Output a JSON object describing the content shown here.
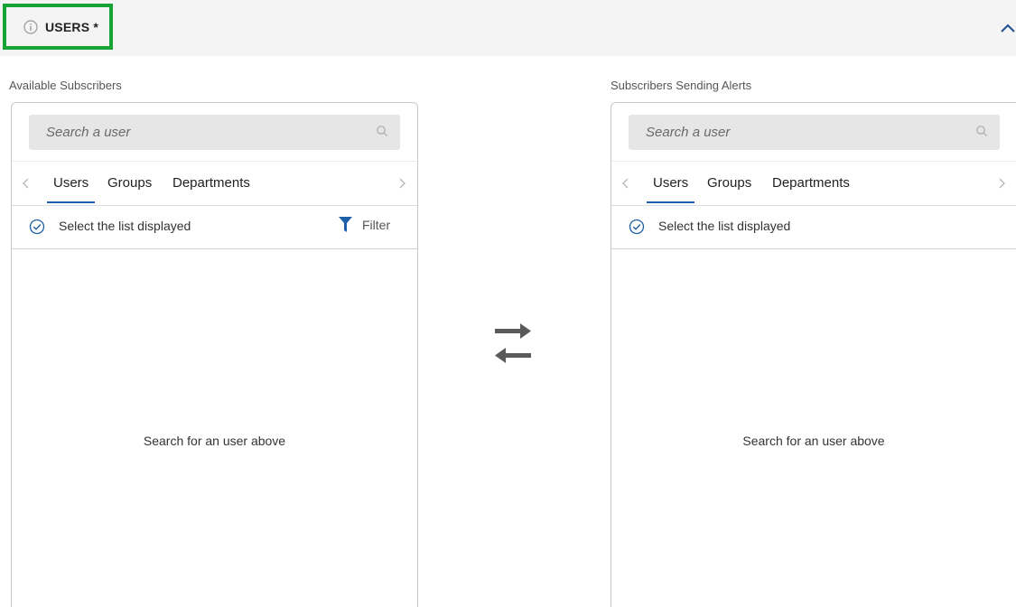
{
  "section": {
    "title": "USERS *",
    "info_icon": "info-circle-icon",
    "collapse_icon": "chevron-up-icon"
  },
  "available": {
    "label": "Available Subscribers",
    "search_placeholder": "Search a user",
    "tabs": [
      {
        "label": "Users",
        "active": true
      },
      {
        "label": "Groups",
        "active": false
      },
      {
        "label": "Departments",
        "active": false
      }
    ],
    "select_all_label": "Select the list displayed",
    "filter_label": "Filter",
    "empty_message": "Search for an user above"
  },
  "sending": {
    "label": "Subscribers Sending Alerts",
    "search_placeholder": "Search a user",
    "tabs": [
      {
        "label": "Users",
        "active": true
      },
      {
        "label": "Groups",
        "active": false
      },
      {
        "label": "Departments",
        "active": false
      }
    ],
    "select_all_label": "Select the list displayed",
    "empty_message": "Search for an user above"
  },
  "transfer_icon": "transfer-arrows-icon",
  "colors": {
    "accent": "#1d5fa8",
    "highlight_border": "#17a335",
    "header_bg": "#f4f4f4",
    "search_bg": "#e6e6e6"
  }
}
